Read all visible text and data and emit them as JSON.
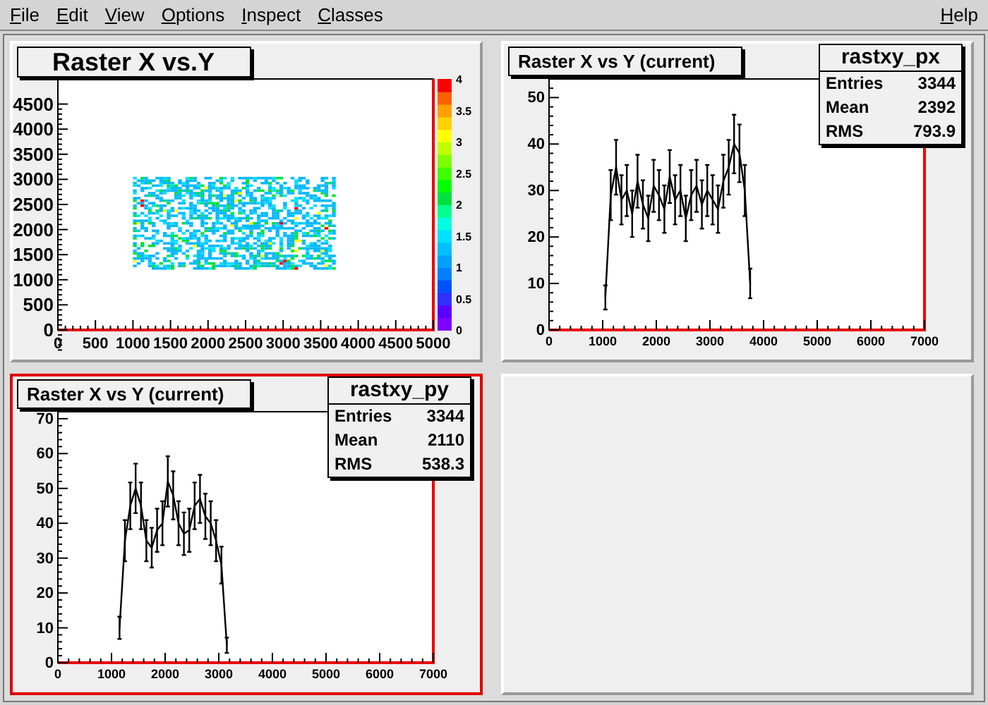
{
  "menu": [
    {
      "label": "File"
    },
    {
      "label": "Edit"
    },
    {
      "label": "View"
    },
    {
      "label": "Options"
    },
    {
      "label": "Inspect"
    },
    {
      "label": "Classes"
    }
  ],
  "help": {
    "label": "Help"
  },
  "pads": [
    {
      "kind": "heatmap",
      "selected": false,
      "title": "Raster X vs.Y",
      "x_tick_labels": [
        "0",
        "500",
        "1000",
        "1500",
        "2000",
        "2500",
        "3000",
        "3500",
        "4000",
        "4500",
        "5000"
      ],
      "y_tick_labels": [
        "4500",
        "4000",
        "3500",
        "3000",
        "2500",
        "2000",
        "1500",
        "1000",
        "500",
        "0"
      ],
      "palette_labels": [
        "4",
        "3.5",
        "3",
        "2.5",
        "2",
        "1.5",
        "1",
        "0.5",
        "0"
      ]
    },
    {
      "kind": "histogram",
      "selected": false,
      "stats": {
        "name": "rastxy_px",
        "rows": [
          {
            "label": "Entries",
            "value": "3344"
          },
          {
            "label": "Mean",
            "value": "2392"
          },
          {
            "label": "RMS",
            "value": "793.9"
          }
        ]
      },
      "chart_data": {
        "type": "line",
        "title": "Raster X vs Y (current)",
        "x": [
          1050,
          1150,
          1250,
          1350,
          1450,
          1550,
          1650,
          1750,
          1850,
          1950,
          2050,
          2150,
          2250,
          2350,
          2450,
          2550,
          2650,
          2750,
          2850,
          2950,
          3050,
          3150,
          3250,
          3350,
          3450,
          3550,
          3650,
          3750
        ],
        "values": [
          7,
          29,
          35,
          28,
          30,
          25,
          32,
          27,
          24,
          31,
          29,
          26,
          33,
          28,
          30,
          24,
          29,
          31,
          27,
          30,
          28,
          26,
          32,
          35,
          40,
          38,
          30,
          10
        ],
        "errors": [
          2.6,
          5.4,
          5.9,
          5.3,
          5.5,
          5,
          5.7,
          5.2,
          4.9,
          5.6,
          5.4,
          5.1,
          5.7,
          5.3,
          5.5,
          4.9,
          5.4,
          5.6,
          5.2,
          5.5,
          5.3,
          5.1,
          5.7,
          5.9,
          6.3,
          6.2,
          5.5,
          3.2
        ],
        "xlim": [
          0,
          7000
        ],
        "ylim": [
          0,
          54
        ],
        "xticks": [
          0,
          1000,
          2000,
          3000,
          4000,
          5000,
          6000,
          7000
        ],
        "yticks": [
          0,
          10,
          20,
          30,
          40,
          50
        ]
      }
    },
    {
      "kind": "histogram",
      "selected": true,
      "stats": {
        "name": "rastxy_py",
        "rows": [
          {
            "label": "Entries",
            "value": "3344"
          },
          {
            "label": "Mean",
            "value": "2110"
          },
          {
            "label": "RMS",
            "value": "538.3"
          }
        ]
      },
      "chart_data": {
        "type": "line",
        "title": "Raster X vs Y (current)",
        "x": [
          1150,
          1250,
          1350,
          1450,
          1550,
          1650,
          1750,
          1850,
          1950,
          2050,
          2150,
          2250,
          2350,
          2450,
          2550,
          2650,
          2750,
          2850,
          2950,
          3050,
          3150
        ],
        "values": [
          10,
          35,
          45,
          50,
          45,
          35,
          33,
          38,
          40,
          52,
          48,
          40,
          37,
          38,
          45,
          47,
          42,
          40,
          35,
          28,
          5
        ],
        "errors": [
          3.2,
          5.9,
          6.7,
          7.1,
          6.7,
          5.9,
          5.7,
          6.2,
          6.3,
          7.2,
          6.9,
          6.3,
          6.1,
          6.2,
          6.7,
          6.9,
          6.5,
          6.3,
          5.9,
          5.3,
          2.2
        ],
        "xlim": [
          0,
          7000
        ],
        "ylim": [
          0,
          72
        ],
        "xticks": [
          0,
          1000,
          2000,
          3000,
          4000,
          5000,
          6000,
          7000
        ],
        "yticks": [
          0,
          10,
          20,
          30,
          40,
          50,
          60,
          70
        ]
      }
    },
    {
      "kind": "empty",
      "selected": false
    }
  ]
}
